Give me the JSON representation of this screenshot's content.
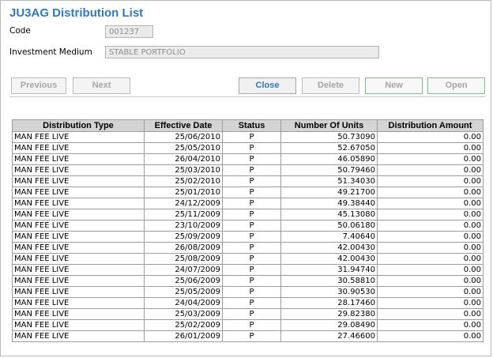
{
  "window": {
    "title": "JU3AG Distribution List"
  },
  "form": {
    "code_label": "Code",
    "code_value": "001237",
    "medium_label": "Investment Medium",
    "medium_value": "STABLE PORTFOLIO"
  },
  "toolbar": {
    "previous": "Previous",
    "next": "Next",
    "close": "Close",
    "delete": "Delete",
    "new": "New",
    "open": "Open"
  },
  "table": {
    "columns": [
      "Distribution Type",
      "Effective Date",
      "Status",
      "Number Of Units",
      "Distribution Amount"
    ],
    "rows": [
      [
        "MAN FEE LIVE",
        "25/06/2010",
        "P",
        "50.73090",
        "0.00"
      ],
      [
        "MAN FEE LIVE",
        "25/05/2010",
        "P",
        "52.67050",
        "0.00"
      ],
      [
        "MAN FEE LIVE",
        "26/04/2010",
        "P",
        "46.05890",
        "0.00"
      ],
      [
        "MAN FEE LIVE",
        "25/03/2010",
        "P",
        "50.79460",
        "0.00"
      ],
      [
        "MAN FEE LIVE",
        "25/02/2010",
        "P",
        "51.34030",
        "0.00"
      ],
      [
        "MAN FEE LIVE",
        "25/01/2010",
        "P",
        "49.21700",
        "0.00"
      ],
      [
        "MAN FEE LIVE",
        "24/12/2009",
        "P",
        "49.38440",
        "0.00"
      ],
      [
        "MAN FEE LIVE",
        "25/11/2009",
        "P",
        "45.13080",
        "0.00"
      ],
      [
        "MAN FEE LIVE",
        "23/10/2009",
        "P",
        "50.06180",
        "0.00"
      ],
      [
        "MAN FEE LIVE",
        "25/09/2009",
        "P",
        "7.40640",
        "0.00"
      ],
      [
        "MAN FEE LIVE",
        "26/08/2009",
        "P",
        "42.00430",
        "0.00"
      ],
      [
        "MAN FEE LIVE",
        "25/08/2009",
        "P",
        "42.00430",
        "0.00"
      ],
      [
        "MAN FEE LIVE",
        "24/07/2009",
        "P",
        "31.94740",
        "0.00"
      ],
      [
        "MAN FEE LIVE",
        "25/06/2009",
        "P",
        "30.58810",
        "0.00"
      ],
      [
        "MAN FEE LIVE",
        "25/05/2009",
        "P",
        "30.90530",
        "0.00"
      ],
      [
        "MAN FEE LIVE",
        "24/04/2009",
        "P",
        "28.17460",
        "0.00"
      ],
      [
        "MAN FEE LIVE",
        "25/03/2009",
        "P",
        "29.82380",
        "0.00"
      ],
      [
        "MAN FEE LIVE",
        "25/02/2009",
        "P",
        "29.08490",
        "0.00"
      ],
      [
        "MAN FEE LIVE",
        "26/01/2009",
        "P",
        "27.46600",
        "0.00"
      ]
    ]
  }
}
